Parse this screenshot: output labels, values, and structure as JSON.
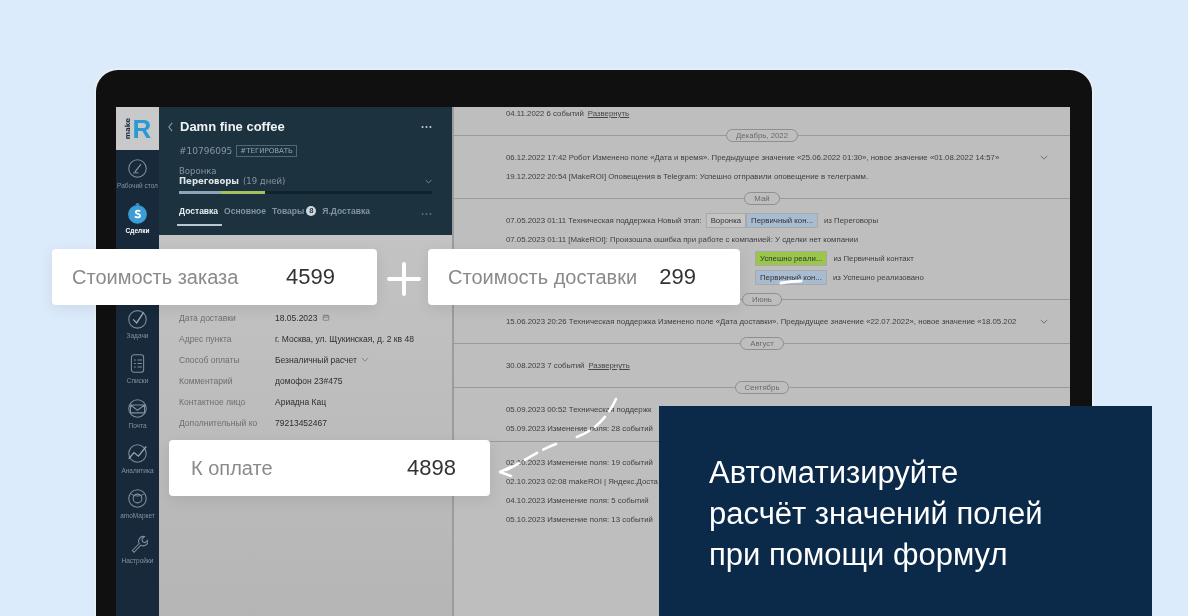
{
  "sidebar": {
    "logo": {
      "small": "make",
      "big": "R"
    },
    "items": [
      {
        "label": "Рабочий стол",
        "selected": false
      },
      {
        "label": "Сделки",
        "selected": true
      },
      {
        "label": "Задачи",
        "selected": false
      },
      {
        "label": "Списки",
        "selected": false
      },
      {
        "label": "Почта",
        "selected": false
      },
      {
        "label": "Аналитика",
        "selected": false
      },
      {
        "label": "amoМаркет",
        "selected": false
      },
      {
        "label": "Настройки",
        "selected": false
      }
    ]
  },
  "lead": {
    "title": "Damn fine coffee",
    "id": "#10796095",
    "tag_button": "#ТЕГИРОВАТЬ",
    "pipeline_label": "Воронка",
    "stage": "Переговоры",
    "stage_days": "(19 дней)",
    "progress": {
      "level": 0.34
    },
    "tabs": [
      {
        "label": "Доставка",
        "selected": true
      },
      {
        "label": "Основное",
        "selected": false
      },
      {
        "label": "Товары",
        "badge": "8",
        "selected": false
      },
      {
        "label": "Я.Доставка",
        "selected": false
      }
    ],
    "fields": [
      {
        "label": "Дата доставки",
        "value": "18.05.2023",
        "kind": "date"
      },
      {
        "label": "Адрес пункта",
        "value": "г. Москва, ул. Щукинская, д. 2 кв 48",
        "kind": "text"
      },
      {
        "label": "Способ оплаты",
        "value": "Безналичный расчет",
        "kind": "select"
      },
      {
        "label": "Комментарий",
        "value": "домофон 23#475",
        "kind": "text"
      },
      {
        "label": "Контактное лицо",
        "value": "Ариадна Кац",
        "kind": "text"
      },
      {
        "label": "Дополнительный ко",
        "value": "79213452467",
        "kind": "text"
      }
    ]
  },
  "timeline": [
    {
      "kind": "event",
      "text": "04.11.2022 6 событий",
      "link": "Развернуть"
    },
    {
      "kind": "month",
      "label": "Декабрь, 2022"
    },
    {
      "kind": "event",
      "text": "06.12.2022 17:42 Робот Изменено поле «Дата и время». Предыдущее значение «25.06.2022 01:30», новое значение «01.08.2022 14:57»",
      "expandable": true
    },
    {
      "kind": "event",
      "text": "19.12.2022 20:54 [MakeROI] Оповещения в Telegram: Успешно отправили оповещение в телеграмм."
    },
    {
      "kind": "month",
      "label": "Май"
    },
    {
      "kind": "event",
      "text": "07.05.2023 01:11 Техническая поддержка Новый этап:",
      "stages": [
        {
          "label": "Воронка",
          "color": "#c4c4c4"
        },
        {
          "label": "Первичный кон...",
          "color": "#a7bbd1"
        }
      ],
      "after": "из Переговоры"
    },
    {
      "kind": "event",
      "text": "07.05.2023 01:11 [MakeROI]: Произошла ошибка при работе с компанией: У сделки нет компании"
    },
    {
      "kind": "partial",
      "stages": [
        {
          "label": "Успешно реали...",
          "color": "#9ac64a"
        }
      ],
      "after": "из Первичный контакт"
    },
    {
      "kind": "partial",
      "stages": [
        {
          "label": "Первичный кон...",
          "color": "#a7bbd1"
        }
      ],
      "after": "из Успешно реализовано"
    },
    {
      "kind": "month",
      "label": "Июнь"
    },
    {
      "kind": "event",
      "text": "15.06.2023 20:26 Техническая поддержка Изменено поле «Дата доставки». Предыдущее значение «22.07.2022», новое значение «18.05.202",
      "expandable": true
    },
    {
      "kind": "month",
      "label": "Август"
    },
    {
      "kind": "event",
      "text": "30.08.2023 7 событий",
      "link": "Развернуть"
    },
    {
      "kind": "month",
      "label": "Сентябрь"
    },
    {
      "kind": "event",
      "text": "05.09.2023 00:52 Техническая поддержк"
    },
    {
      "kind": "event",
      "text": "05.09.2023 Изменение поля: 28 событий"
    },
    {
      "kind": "divider"
    },
    {
      "kind": "event",
      "text": "02.10.2023 Изменение поля: 19 событий"
    },
    {
      "kind": "event",
      "text": "02.10.2023 02:08 makeROI | Яндекс.Доста"
    },
    {
      "kind": "event",
      "text": "04.10.2023 Изменение поля: 5 событий"
    },
    {
      "kind": "event",
      "text": "05.10.2023 Изменение поля: 13 событий"
    }
  ],
  "formula": {
    "order_cost": {
      "label": "Стоимость заказа",
      "value": "4599"
    },
    "delivery_cost": {
      "label": "Стоимость доставки",
      "value": "299"
    },
    "total": {
      "label": "К оплате",
      "value": "4898"
    }
  },
  "headline": "Автоматизируйте\nрасчёт значений полей\nпри помощи формул"
}
